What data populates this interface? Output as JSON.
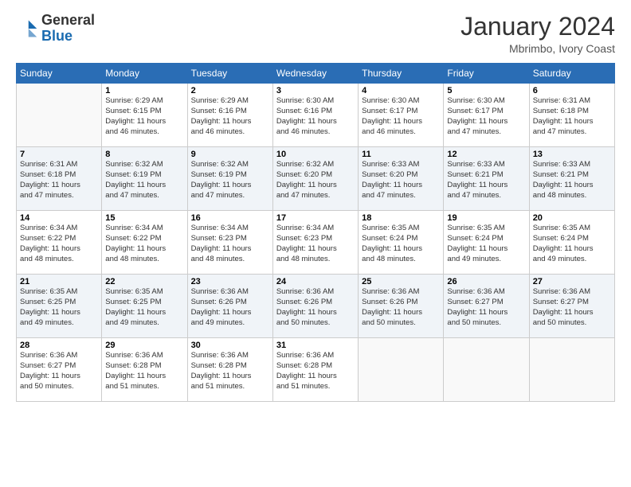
{
  "logo": {
    "general": "General",
    "blue": "Blue"
  },
  "header": {
    "month": "January 2024",
    "location": "Mbrimbo, Ivory Coast"
  },
  "weekdays": [
    "Sunday",
    "Monday",
    "Tuesday",
    "Wednesday",
    "Thursday",
    "Friday",
    "Saturday"
  ],
  "weeks": [
    [
      {
        "day": null,
        "info": null
      },
      {
        "day": "1",
        "info": "Sunrise: 6:29 AM\nSunset: 6:15 PM\nDaylight: 11 hours\nand 46 minutes."
      },
      {
        "day": "2",
        "info": "Sunrise: 6:29 AM\nSunset: 6:16 PM\nDaylight: 11 hours\nand 46 minutes."
      },
      {
        "day": "3",
        "info": "Sunrise: 6:30 AM\nSunset: 6:16 PM\nDaylight: 11 hours\nand 46 minutes."
      },
      {
        "day": "4",
        "info": "Sunrise: 6:30 AM\nSunset: 6:17 PM\nDaylight: 11 hours\nand 46 minutes."
      },
      {
        "day": "5",
        "info": "Sunrise: 6:30 AM\nSunset: 6:17 PM\nDaylight: 11 hours\nand 47 minutes."
      },
      {
        "day": "6",
        "info": "Sunrise: 6:31 AM\nSunset: 6:18 PM\nDaylight: 11 hours\nand 47 minutes."
      }
    ],
    [
      {
        "day": "7",
        "info": "Sunrise: 6:31 AM\nSunset: 6:18 PM\nDaylight: 11 hours\nand 47 minutes."
      },
      {
        "day": "8",
        "info": "Sunrise: 6:32 AM\nSunset: 6:19 PM\nDaylight: 11 hours\nand 47 minutes."
      },
      {
        "day": "9",
        "info": "Sunrise: 6:32 AM\nSunset: 6:19 PM\nDaylight: 11 hours\nand 47 minutes."
      },
      {
        "day": "10",
        "info": "Sunrise: 6:32 AM\nSunset: 6:20 PM\nDaylight: 11 hours\nand 47 minutes."
      },
      {
        "day": "11",
        "info": "Sunrise: 6:33 AM\nSunset: 6:20 PM\nDaylight: 11 hours\nand 47 minutes."
      },
      {
        "day": "12",
        "info": "Sunrise: 6:33 AM\nSunset: 6:21 PM\nDaylight: 11 hours\nand 47 minutes."
      },
      {
        "day": "13",
        "info": "Sunrise: 6:33 AM\nSunset: 6:21 PM\nDaylight: 11 hours\nand 48 minutes."
      }
    ],
    [
      {
        "day": "14",
        "info": "Sunrise: 6:34 AM\nSunset: 6:22 PM\nDaylight: 11 hours\nand 48 minutes."
      },
      {
        "day": "15",
        "info": "Sunrise: 6:34 AM\nSunset: 6:22 PM\nDaylight: 11 hours\nand 48 minutes."
      },
      {
        "day": "16",
        "info": "Sunrise: 6:34 AM\nSunset: 6:23 PM\nDaylight: 11 hours\nand 48 minutes."
      },
      {
        "day": "17",
        "info": "Sunrise: 6:34 AM\nSunset: 6:23 PM\nDaylight: 11 hours\nand 48 minutes."
      },
      {
        "day": "18",
        "info": "Sunrise: 6:35 AM\nSunset: 6:24 PM\nDaylight: 11 hours\nand 48 minutes."
      },
      {
        "day": "19",
        "info": "Sunrise: 6:35 AM\nSunset: 6:24 PM\nDaylight: 11 hours\nand 49 minutes."
      },
      {
        "day": "20",
        "info": "Sunrise: 6:35 AM\nSunset: 6:24 PM\nDaylight: 11 hours\nand 49 minutes."
      }
    ],
    [
      {
        "day": "21",
        "info": "Sunrise: 6:35 AM\nSunset: 6:25 PM\nDaylight: 11 hours\nand 49 minutes."
      },
      {
        "day": "22",
        "info": "Sunrise: 6:35 AM\nSunset: 6:25 PM\nDaylight: 11 hours\nand 49 minutes."
      },
      {
        "day": "23",
        "info": "Sunrise: 6:36 AM\nSunset: 6:26 PM\nDaylight: 11 hours\nand 49 minutes."
      },
      {
        "day": "24",
        "info": "Sunrise: 6:36 AM\nSunset: 6:26 PM\nDaylight: 11 hours\nand 50 minutes."
      },
      {
        "day": "25",
        "info": "Sunrise: 6:36 AM\nSunset: 6:26 PM\nDaylight: 11 hours\nand 50 minutes."
      },
      {
        "day": "26",
        "info": "Sunrise: 6:36 AM\nSunset: 6:27 PM\nDaylight: 11 hours\nand 50 minutes."
      },
      {
        "day": "27",
        "info": "Sunrise: 6:36 AM\nSunset: 6:27 PM\nDaylight: 11 hours\nand 50 minutes."
      }
    ],
    [
      {
        "day": "28",
        "info": "Sunrise: 6:36 AM\nSunset: 6:27 PM\nDaylight: 11 hours\nand 50 minutes."
      },
      {
        "day": "29",
        "info": "Sunrise: 6:36 AM\nSunset: 6:28 PM\nDaylight: 11 hours\nand 51 minutes."
      },
      {
        "day": "30",
        "info": "Sunrise: 6:36 AM\nSunset: 6:28 PM\nDaylight: 11 hours\nand 51 minutes."
      },
      {
        "day": "31",
        "info": "Sunrise: 6:36 AM\nSunset: 6:28 PM\nDaylight: 11 hours\nand 51 minutes."
      },
      {
        "day": null,
        "info": null
      },
      {
        "day": null,
        "info": null
      },
      {
        "day": null,
        "info": null
      }
    ]
  ]
}
